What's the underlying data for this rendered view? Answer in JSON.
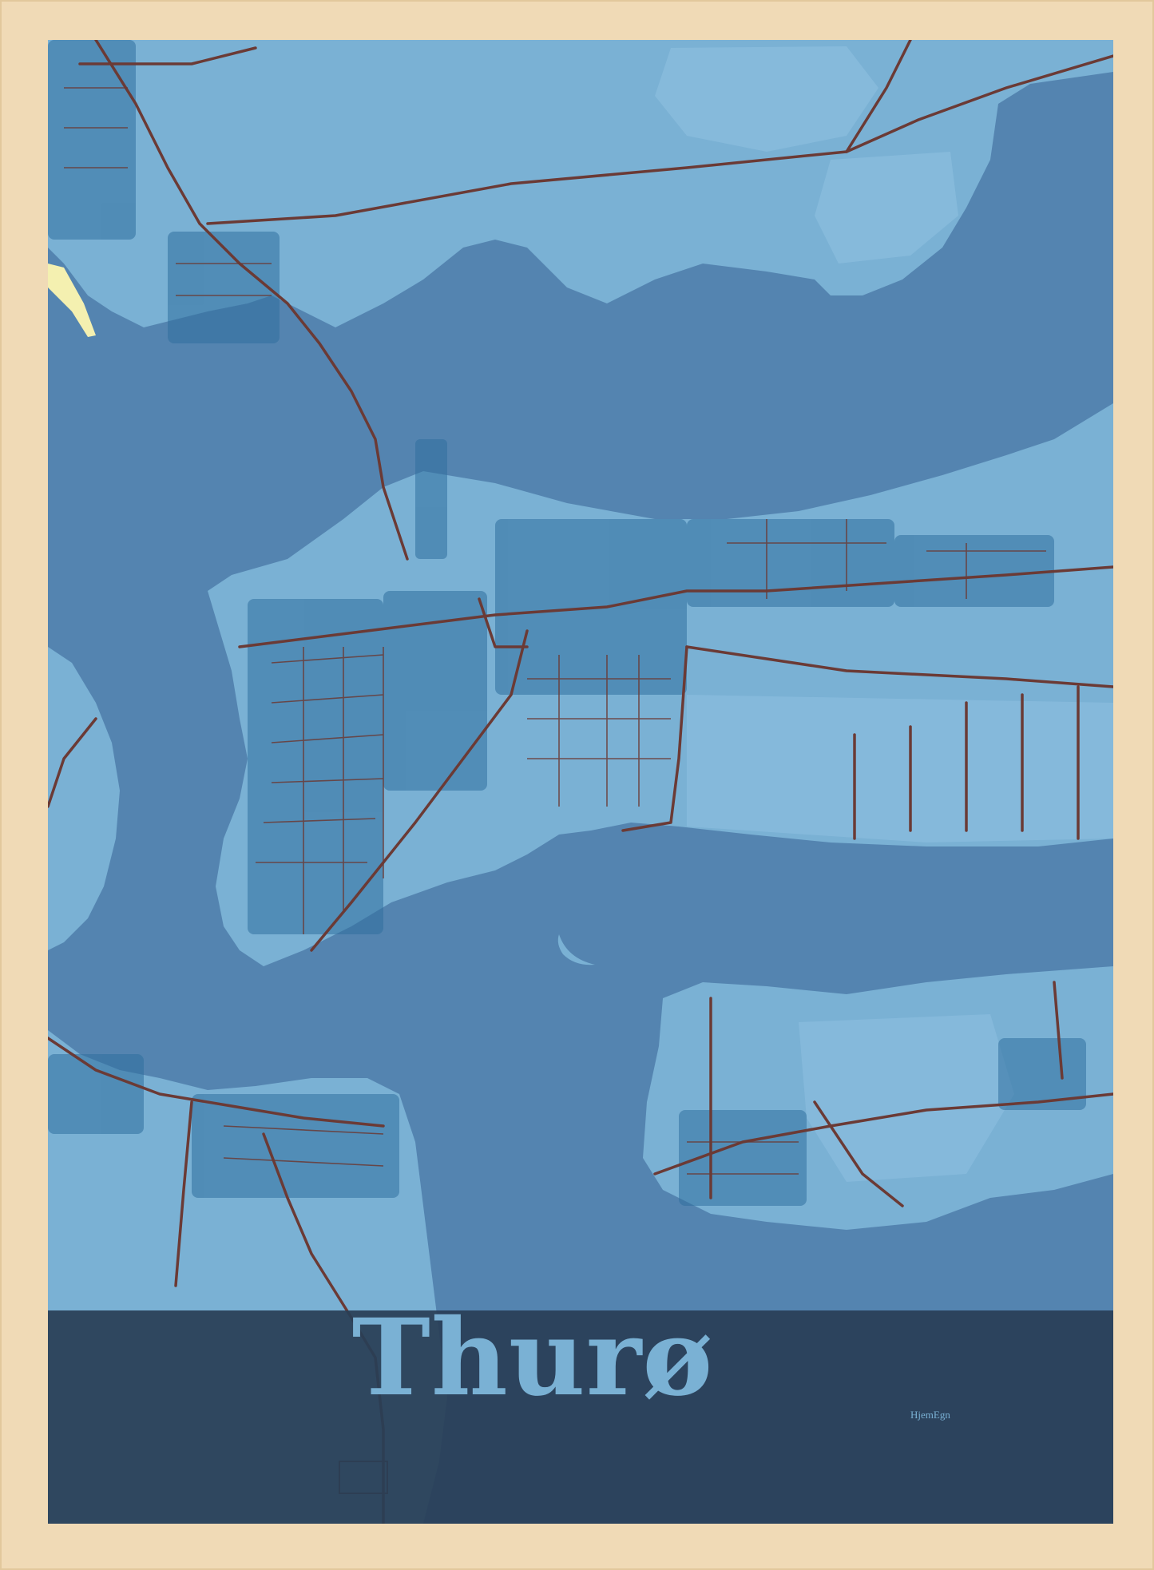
{
  "poster": {
    "city_name": "Thurø",
    "brand": "HjemEgn"
  },
  "colors": {
    "frame": "#f0dab6",
    "water": "#5484b0",
    "land": "#7ab1d4",
    "land_fields": "#8cbdde",
    "buildings": "#2f6f9f",
    "roads": "#6b3a35",
    "sand": "#f4f0b0",
    "title_band": "#293e56",
    "title_text": "#7ab1d4"
  }
}
